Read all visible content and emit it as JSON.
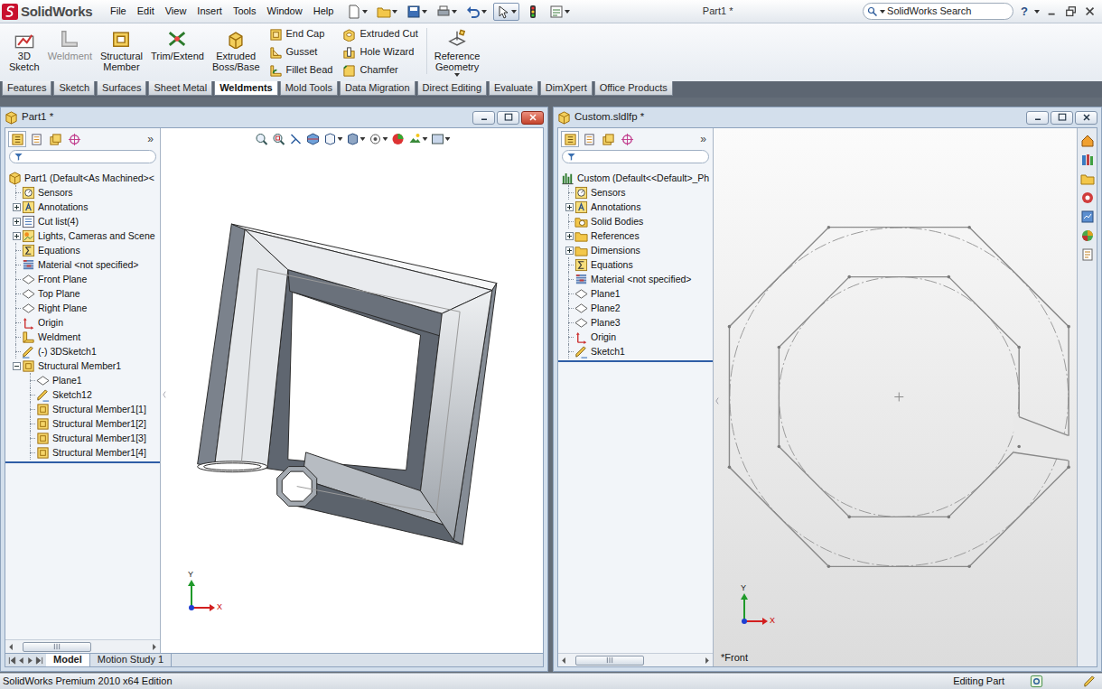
{
  "app": {
    "name": "SolidWorks"
  },
  "menu": [
    "File",
    "Edit",
    "View",
    "Insert",
    "Tools",
    "Window",
    "Help"
  ],
  "quick_access": [
    {
      "kind": "new",
      "pressed": false
    },
    {
      "kind": "open",
      "pressed": false
    },
    {
      "kind": "save",
      "pressed": false
    },
    {
      "kind": "print",
      "pressed": false
    },
    {
      "kind": "undo",
      "pressed": false
    },
    {
      "kind": "select",
      "pressed": true
    },
    {
      "kind": "rebuild",
      "pressed": false
    },
    {
      "kind": "options",
      "pressed": false
    }
  ],
  "title": "Part1 *",
  "search": {
    "placeholder": "SolidWorks Search"
  },
  "help": "?",
  "command_manager": {
    "large": [
      {
        "label": "3D Sketch",
        "kind": "sketch3d",
        "disabled": false
      },
      {
        "label": "Weldment",
        "kind": "weldment",
        "disabled": true
      },
      {
        "label": "Structural Member",
        "kind": "member",
        "disabled": false
      },
      {
        "label": "Trim/Extend",
        "kind": "trim",
        "disabled": false
      },
      {
        "label": "Extruded Boss/Base",
        "kind": "boss",
        "disabled": false
      }
    ],
    "small_columns": [
      [
        {
          "label": "End Cap",
          "kind": "endcap",
          "disabled": false
        },
        {
          "label": "Gusset",
          "kind": "gusset",
          "disabled": false
        },
        {
          "label": "Fillet Bead",
          "kind": "fillet",
          "disabled": false
        }
      ],
      [
        {
          "label": "Extruded Cut",
          "kind": "cut",
          "disabled": false
        },
        {
          "label": "Hole Wizard",
          "kind": "hole",
          "disabled": false
        },
        {
          "label": "Chamfer",
          "kind": "chamfer",
          "disabled": false
        }
      ]
    ],
    "reference": {
      "label": "Reference Geometry",
      "kind": "refgeom",
      "disabled": false
    }
  },
  "command_tabs": [
    {
      "label": "Features",
      "selected": false
    },
    {
      "label": "Sketch",
      "selected": false
    },
    {
      "label": "Surfaces",
      "selected": false
    },
    {
      "label": "Sheet Metal",
      "selected": false
    },
    {
      "label": "Weldments",
      "selected": true
    },
    {
      "label": "Mold Tools",
      "selected": false
    },
    {
      "label": "Data Migration",
      "selected": false
    },
    {
      "label": "Direct Editing",
      "selected": false
    },
    {
      "label": "Evaluate",
      "selected": false
    },
    {
      "label": "DimXpert",
      "selected": false
    },
    {
      "label": "Office Products",
      "selected": false
    }
  ],
  "tree_tabs": [
    {
      "kind": "feature",
      "selected": true
    },
    {
      "kind": "property",
      "selected": false
    },
    {
      "kind": "config",
      "selected": false
    },
    {
      "kind": "dimxpert",
      "selected": false
    }
  ],
  "windows": [
    {
      "title": "Part1 *",
      "active": true,
      "kind": "frame",
      "tree_more": "»",
      "tree": [
        {
          "label": "Part1 (Default<As Machined><",
          "kind": "part",
          "level": 0
        },
        {
          "label": "Sensors",
          "kind": "sensor",
          "level": 1
        },
        {
          "label": "Annotations",
          "kind": "annotation",
          "level": 1,
          "expanded": false
        },
        {
          "label": "Cut list(4)",
          "kind": "cutlist",
          "level": 1,
          "expanded": false
        },
        {
          "label": "Lights, Cameras and Scene",
          "kind": "lights",
          "level": 1,
          "expanded": false
        },
        {
          "label": "Equations",
          "kind": "equations",
          "level": 1
        },
        {
          "label": "Material <not specified>",
          "kind": "material",
          "level": 1
        },
        {
          "label": "Front Plane",
          "kind": "plane",
          "level": 1
        },
        {
          "label": "Top Plane",
          "kind": "plane",
          "level": 1
        },
        {
          "label": "Right Plane",
          "kind": "plane",
          "level": 1
        },
        {
          "label": "Origin",
          "kind": "origin",
          "level": 1
        },
        {
          "label": "Weldment",
          "kind": "weldment",
          "level": 1
        },
        {
          "label": "(-) 3DSketch1",
          "kind": "sketch3d",
          "level": 1
        },
        {
          "label": "Structural Member1",
          "kind": "member",
          "level": 1,
          "expanded": true
        },
        {
          "label": "Plane1",
          "kind": "plane",
          "level": 2
        },
        {
          "label": "Sketch12",
          "kind": "sketch",
          "level": 2
        },
        {
          "label": "Structural Member1[1]",
          "kind": "member",
          "level": 2
        },
        {
          "label": "Structural Member1[2]",
          "kind": "member",
          "level": 2
        },
        {
          "label": "Structural Member1[3]",
          "kind": "member",
          "level": 2
        },
        {
          "label": "Structural Member1[4]",
          "kind": "member",
          "level": 2
        }
      ],
      "bottom_tabs": [
        {
          "label": "Model",
          "selected": true
        },
        {
          "label": "Motion Study 1",
          "selected": false
        }
      ],
      "triad": {
        "y": "Y",
        "x": "X"
      }
    },
    {
      "title": "Custom.sldlfp *",
      "active": false,
      "kind": "profile",
      "tree_more": "»",
      "tree": [
        {
          "label": "Custom (Default<<Default>_Ph",
          "kind": "library",
          "level": 0
        },
        {
          "label": "Sensors",
          "kind": "sensor",
          "level": 1
        },
        {
          "label": "Annotations",
          "kind": "annotation",
          "level": 1,
          "expanded": false
        },
        {
          "label": "Solid Bodies",
          "kind": "bodies",
          "level": 1
        },
        {
          "label": "References",
          "kind": "folder",
          "level": 1,
          "expanded": false
        },
        {
          "label": "Dimensions",
          "kind": "folder",
          "level": 1,
          "expanded": false
        },
        {
          "label": "Equations",
          "kind": "equations",
          "level": 1
        },
        {
          "label": "Material <not specified>",
          "kind": "material",
          "level": 1
        },
        {
          "label": "Plane1",
          "kind": "plane",
          "level": 1
        },
        {
          "label": "Plane2",
          "kind": "plane",
          "level": 1
        },
        {
          "label": "Plane3",
          "kind": "plane",
          "level": 1
        },
        {
          "label": "Origin",
          "kind": "origin",
          "level": 1
        },
        {
          "label": "Sketch1",
          "kind": "sketch",
          "level": 1
        }
      ],
      "bottom_tabs": [],
      "view_label": "*Front",
      "triad": {
        "y": "Y",
        "x": "X"
      }
    }
  ],
  "status_bar": {
    "left": "SolidWorks Premium 2010 x64 Edition",
    "right": "Editing Part"
  }
}
